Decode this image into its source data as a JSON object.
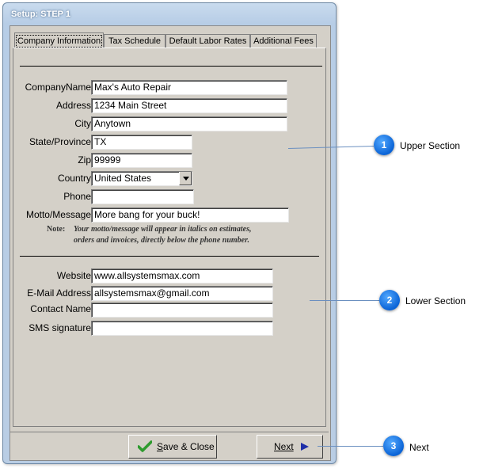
{
  "window": {
    "title": "Setup: STEP 1"
  },
  "tabs": [
    {
      "label": "Company Information"
    },
    {
      "label": "Tax Schedule"
    },
    {
      "label": "Default Labor Rates"
    },
    {
      "label": "Additional Fees"
    }
  ],
  "upper": {
    "company_name": {
      "label": "CompanyName",
      "value": "Max's Auto Repair"
    },
    "address": {
      "label": "Address",
      "value": "1234 Main Street"
    },
    "city": {
      "label": "City",
      "value": "Anytown"
    },
    "state": {
      "label": "State/Province",
      "value": "TX"
    },
    "zip": {
      "label": "Zip",
      "value": "99999"
    },
    "country": {
      "label": "Country",
      "value": "United States"
    },
    "phone": {
      "label": "Phone",
      "value": ""
    },
    "motto": {
      "label": "Motto/Message",
      "value": "More bang for your buck!"
    },
    "note_label": "Note:",
    "note_line1": "Your motto/message will appear  in italics on estimates,",
    "note_line2": "orders and invoices, directly below the phone number."
  },
  "lower": {
    "website": {
      "label": "Website",
      "value": "www.allsystemsmax.com"
    },
    "email": {
      "label": "E-Mail Address",
      "value": "allsystemsmax@gmail.com"
    },
    "contact": {
      "label": "Contact Name",
      "value": ""
    },
    "sms": {
      "label": "SMS signature",
      "value": ""
    }
  },
  "buttons": {
    "save_label_u": "S",
    "save_label_rest": "ave & Close",
    "next_label": "Next"
  },
  "callouts": [
    {
      "number": "1",
      "text": "Upper Section"
    },
    {
      "number": "2",
      "text": "Lower Section"
    },
    {
      "number": "3",
      "text": "Next"
    }
  ],
  "colors": {
    "accent": "#0a63d6",
    "check": "#2e9b2e",
    "next_arrow": "#1f2fa8",
    "callout_line": "#6a8fc0"
  }
}
